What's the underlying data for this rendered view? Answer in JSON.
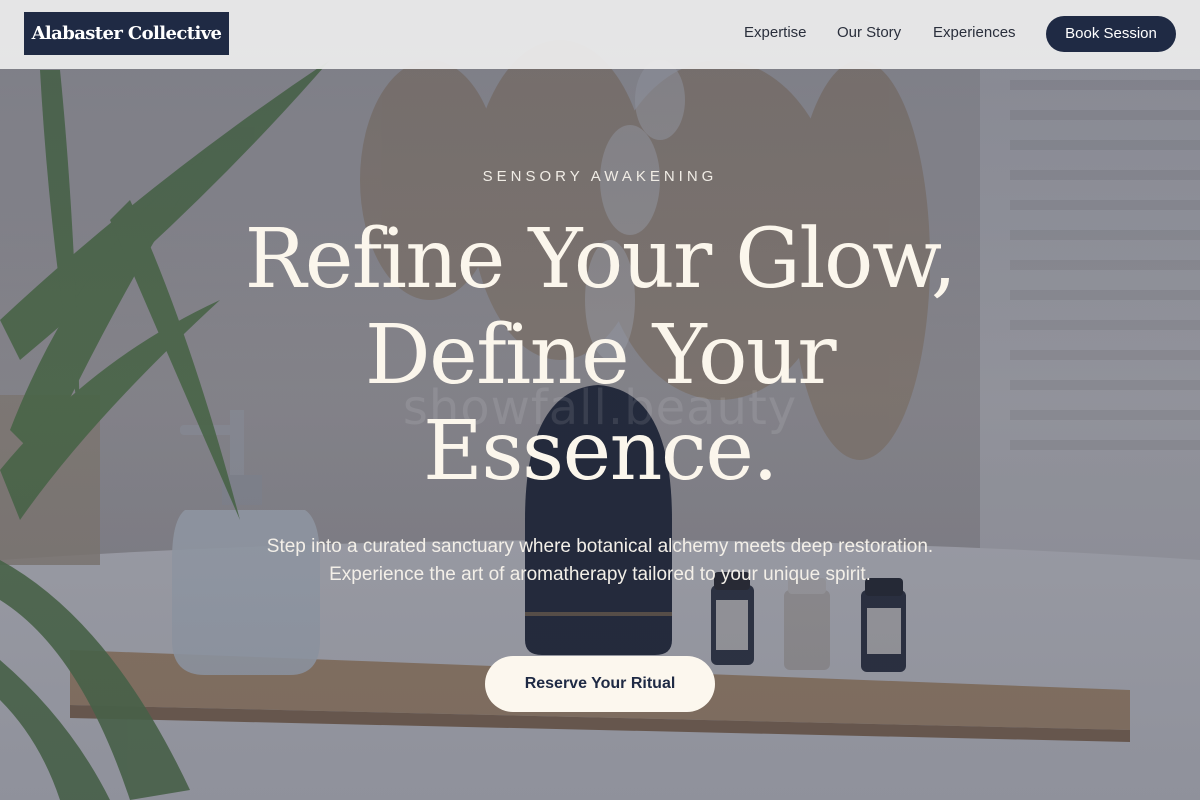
{
  "header": {
    "logo_text": "Alabaster Collective",
    "nav": [
      {
        "label": "Expertise"
      },
      {
        "label": "Our Story"
      },
      {
        "label": "Experiences"
      }
    ],
    "book_label": "Book Session"
  },
  "hero": {
    "eyebrow": "SENSORY AWAKENING",
    "headline_lines": [
      "Refine Your Glow,",
      "Define Your",
      "Essence."
    ],
    "subtext": "Step into a curated sanctuary where botanical alchemy meets deep restoration. Experience the art of aromatherapy tailored to your unique spirit.",
    "cta_label": "Reserve Your Ritual",
    "watermark": "showfall.beauty"
  },
  "colors": {
    "brand_navy": "#1f2a44",
    "cream": "#fcf7ee",
    "overlay": "#2e344a"
  },
  "background_image": {
    "depicts": [
      "palm-leaves",
      "glass-soap-dispenser",
      "aroma-diffuser",
      "essential-oil-bottles",
      "wooden-bath-tray",
      "pampas-grass",
      "window-shutters"
    ]
  }
}
